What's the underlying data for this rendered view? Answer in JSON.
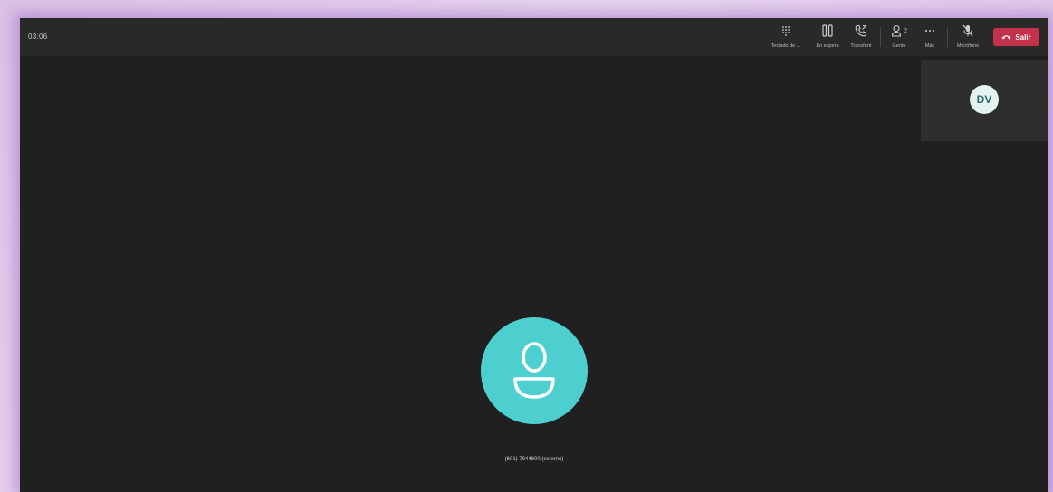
{
  "call": {
    "timer": "03:06",
    "caller_label": "(601) 7944600 (externo)"
  },
  "toolbar": {
    "dialpad_label": "Teclado de ...",
    "hold_label": "En espera",
    "transfer_label": "Transferir",
    "people_label": "Gente",
    "people_count": "2",
    "more_label": "Más",
    "mic_label": "Micrófono",
    "leave_label": "Salir"
  },
  "self_view": {
    "initials": "DV"
  },
  "icons": {
    "dialpad": "dialpad-icon",
    "hold": "pause-icon",
    "transfer": "phone-transfer-icon",
    "people": "people-icon",
    "more": "more-icon",
    "mic": "mic-off-icon",
    "leave": "phone-hangup-icon",
    "caller": "person-icon"
  },
  "colors": {
    "stage_bg": "#202020",
    "toolbar_bg": "#292929",
    "leave_button": "#c4314b",
    "caller_avatar": "#4ecfcf",
    "self_avatar": "#e4f2f2"
  }
}
